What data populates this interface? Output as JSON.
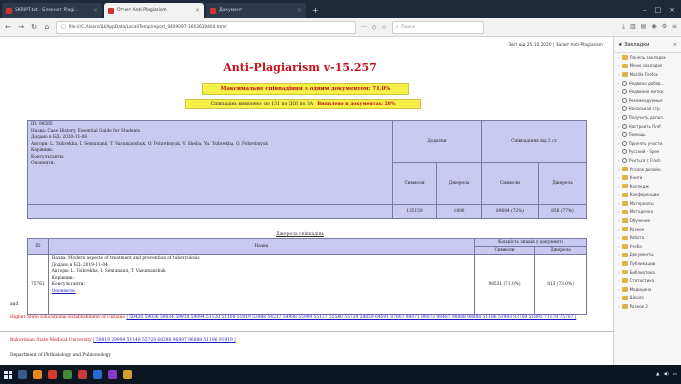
{
  "browser": {
    "tabs": [
      {
        "label": "SKRIPT.txt - Блокнот Plagi..."
      },
      {
        "label": "Отчет Anti-Plagiarism"
      },
      {
        "label": "Документ"
      }
    ],
    "url": "file:///C:/Users/Ш/AppData/Local/Temp/report_9409097-1603619464.html",
    "search_placeholder": "Поиск"
  },
  "sidebar": {
    "title": "Закладки",
    "items": [
      "Панель закладок",
      "Меню закладок",
      "Mozilla Firefox",
      "Недавно добав...",
      "Недавние метки",
      "Рекомендуемые",
      "Начальная стр.",
      "Получить допол.",
      "Настроить Firef.",
      "Помощь",
      "Принять участи.",
      "Русский - Spee",
      "Учиться с Flash",
      "Уголок дизайн.",
      "Книги",
      "Колледж",
      "Конференции",
      "Материалы",
      "Методичка",
      "Обучение",
      "Разное",
      "Работа",
      "Учеба",
      "Документы",
      "Публикации",
      "Библиотека",
      "Статистика",
      "Медицина",
      "Школа",
      "Разное 2"
    ]
  },
  "page": {
    "topline": "Звіт від 25.10.2020 | Запит Anti-Plagiarism",
    "title": "Anti-Plagiarism v-15.257",
    "max_similarity": "Максимальне співпадіння з одним документом: 71.0%",
    "found_line": "Співпадінь виявлено: по 131 по ДОІ по ЗА",
    "found_value": "Виявлено в документах: 28%",
    "doc_info": [
      "ID: 98585",
      "Назва: Case History. Essential Guide for Students",
      "Додано в БД: 2020-11-06",
      "Автори: L. Tsibrekha, I. Semunanii, T. Vasumanshuk, O. Pohrebnyuk, V. Sheba, Yu. Tsibrekha, O. Pohrebnyuk",
      "Керівник:",
      "Консультанти:",
      "Опоненти:"
    ],
    "table1_headers": {
      "dodalni": "Додатки",
      "all": "Співпадіння від 5 ст"
    },
    "table1_subheaders": [
      "Символи",
      "Джерела",
      "Символи",
      "Джерела"
    ],
    "table1_values": [
      "135159",
      "1896",
      "89684 (72%)",
      "856 (77%)"
    ],
    "caption": "Джерела співпадінь",
    "table2_headers": {
      "id": "ID",
      "name": "Назва",
      "match": "Кількість знаків у документі"
    },
    "table2_subheaders": [
      "Символи",
      "Джерела"
    ],
    "table2_row": {
      "id": "75761",
      "info": [
        "Назва: Modern aspects of treatment and prevention of tuberculosis",
        "Додано в БД: 2019-11-04",
        "Автори: L. Tsibrekha, I. Semunanii, T. Vasumanshuk",
        "Керівник:",
        "Консультанти:",
        "Опоненти:"
      ],
      "symbols": "98531 (71.0%)",
      "sources": "813 (73.0%)"
    },
    "bottom_label": "and",
    "bottom_red1": "Higher State Educational Establishment of Ukraine",
    "bottom_links1": "| 50420 59036 59034 59918 59994 51120 51108 51819 53988 54217 54998 55999 55127 55540 55720 58859 64591 07807 98071 98073 98487 98888 98888 51186 51993 93709 51895 71178 75707 |",
    "bottom_red2": "Bukovinian State Medical University",
    "bottom_links2": "| 59819 29999 51148 55728 68286 96897 96888 51196 91919 |",
    "bottom_footer": "Department of Phthisiology and Pulmonology"
  }
}
